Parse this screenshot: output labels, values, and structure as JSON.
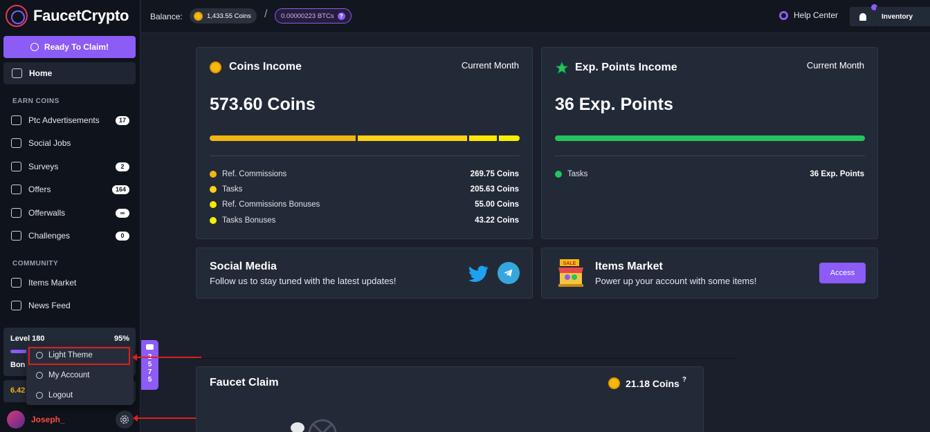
{
  "app": {
    "name": "FaucetCrypto"
  },
  "sidebar": {
    "claim_label": "Ready To Claim!",
    "home_label": "Home",
    "earn_title": "EARN COINS",
    "earn_items": [
      {
        "label": "Ptc Advertisements",
        "badge": "17"
      },
      {
        "label": "Social Jobs",
        "badge": ""
      },
      {
        "label": "Surveys",
        "badge": "2"
      },
      {
        "label": "Offers",
        "badge": "164"
      },
      {
        "label": "Offerwalls",
        "badge": "∞"
      },
      {
        "label": "Challenges",
        "badge": "0"
      }
    ],
    "community_title": "COMMUNITY",
    "community_items": [
      {
        "label": "Items Market"
      },
      {
        "label": "News Feed"
      }
    ],
    "level": {
      "label": "Level 180",
      "percent_label": "95%",
      "bonus_partial": "Bon",
      "progress": 0.95
    },
    "coin_partial": "6.42",
    "username": "Joseph_"
  },
  "dropdown": {
    "items": [
      {
        "label": "Light Theme"
      },
      {
        "label": "My Account"
      },
      {
        "label": "Logout"
      }
    ]
  },
  "chat": {
    "count_digits": [
      "2",
      "5",
      "7",
      "5"
    ]
  },
  "topbar": {
    "balance_label": "Balance:",
    "coins": "1,433.55 Coins",
    "separator": "/",
    "btc": "0.00000223 BTCs",
    "btc_help": "?",
    "help_center": "Help Center",
    "inventory": "Inventory"
  },
  "coins_income": {
    "title": "Coins Income",
    "period": "Current Month",
    "total": "573.60 Coins",
    "rows": [
      {
        "label": "Ref. Commissions",
        "value": "269.75 Coins",
        "color": "#f5b912"
      },
      {
        "label": "Tasks",
        "value": "205.63 Coins",
        "color": "#fcd116"
      },
      {
        "label": "Ref. Commissions Bonuses",
        "value": "55.00 Coins",
        "color": "#ffe600"
      },
      {
        "label": "Tasks Bonuses",
        "value": "43.22 Coins",
        "color": "#f4f000"
      }
    ]
  },
  "exp_income": {
    "title": "Exp. Points Income",
    "period": "Current Month",
    "total": "36 Exp. Points",
    "rows": [
      {
        "label": "Tasks",
        "value": "36 Exp. Points",
        "color": "#22c55e"
      }
    ]
  },
  "social": {
    "title": "Social Media",
    "subtitle": "Follow us to stay tuned with the latest updates!"
  },
  "market": {
    "title": "Items Market",
    "subtitle": "Power up your account with some items!",
    "button": "Access",
    "sale_label": "SALE"
  },
  "faucet": {
    "title": "Faucet Claim",
    "reward": "21.18 Coins",
    "help": "?"
  },
  "colors": {
    "accent": "#8b5cf6",
    "annotation": "#e01e1e"
  }
}
